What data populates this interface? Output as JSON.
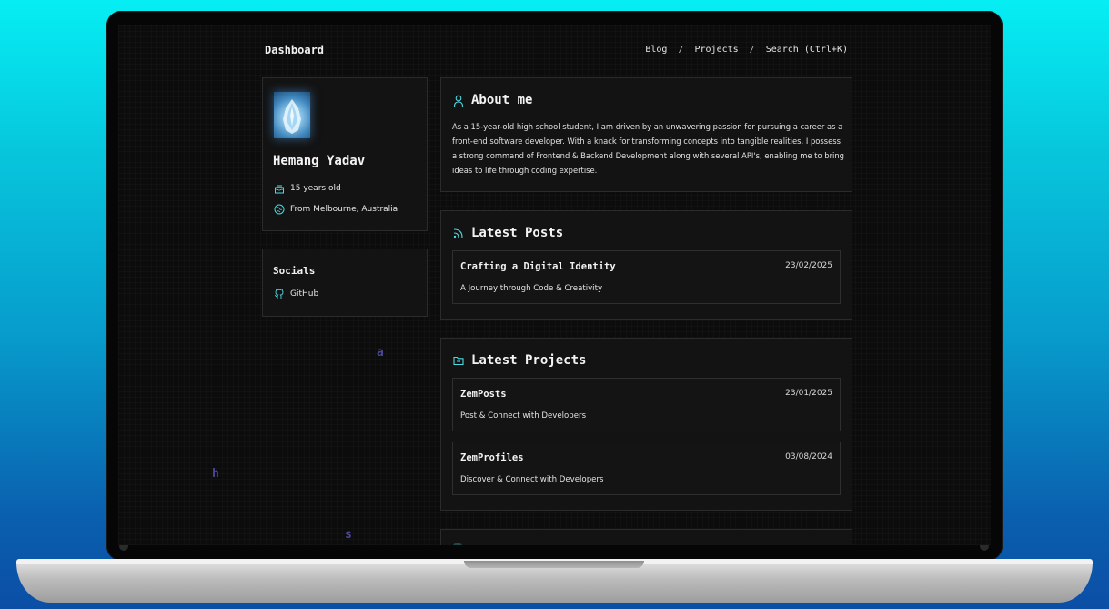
{
  "nav": {
    "title": "Dashboard",
    "links": [
      "Blog",
      "/",
      "Projects",
      "/",
      "Search (Ctrl+K)"
    ]
  },
  "profile": {
    "name": "Hemang Yadav",
    "age": "15 years old",
    "location": "From Melbourne, Australia"
  },
  "socials": {
    "title": "Socials",
    "items": [
      "GitHub"
    ]
  },
  "about": {
    "title": "About me",
    "text": "As a 15-year-old high school student, I am driven by an unwavering passion for pursuing a career as a front-end software developer. With a knack for transforming concepts into tangible realities, I possess a strong command of Frontend & Backend Development along with several API's, enabling me to bring ideas to life through coding expertise."
  },
  "posts": {
    "title": "Latest Posts",
    "items": [
      {
        "title": "Crafting a Digital Identity",
        "date": "23/02/2025",
        "desc": "A Journey through Code & Creativity"
      }
    ]
  },
  "projects": {
    "title": "Latest Projects",
    "items": [
      {
        "title": "ZemPosts",
        "date": "23/01/2025",
        "desc": "Post & Connect with Developers"
      },
      {
        "title": "ZemProfiles",
        "date": "03/08/2024",
        "desc": "Discover & Connect with Developers"
      }
    ]
  },
  "floating_letters": [
    "a",
    "h",
    "s"
  ],
  "colors": {
    "accent": "#4fd8e0",
    "background": "#0c0c0c",
    "card": "#131313",
    "border": "#2b2b2b"
  }
}
